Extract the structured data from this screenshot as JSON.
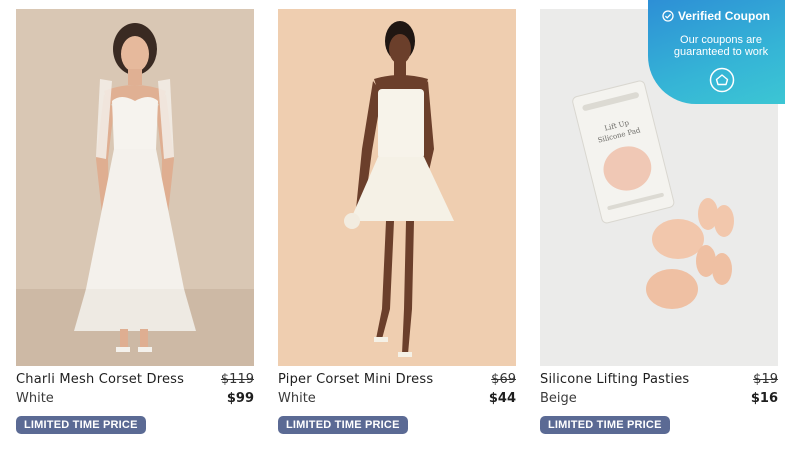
{
  "coupon": {
    "title": "Verified Coupon",
    "text": "Our coupons are guaranteed to work",
    "check_icon": "check-circle-icon",
    "logo_icon": "coupon-logo-icon"
  },
  "products": [
    {
      "name": "Charli Mesh Corset Dress",
      "color": "White",
      "old_price": "$119",
      "price": "$99",
      "badge": "LIMITED TIME PRICE",
      "image": "white tulle corset maxi dress on model"
    },
    {
      "name": "Piper Corset Mini Dress",
      "color": "White",
      "old_price": "$69",
      "price": "$44",
      "badge": "LIMITED TIME PRICE",
      "image": "white corset mini dress on model"
    },
    {
      "name": "Silicone Lifting Pasties",
      "color": "Beige",
      "old_price": "$19",
      "price": "$16",
      "badge": "LIMITED TIME PRICE",
      "image": "silicone lifting pasties with package"
    }
  ],
  "package_text": [
    "Lift Up",
    "Silicone Pad"
  ],
  "colors": {
    "badge": "#5b6a94",
    "coupon_start": "#2d8fd6",
    "coupon_end": "#3cc6d4"
  }
}
